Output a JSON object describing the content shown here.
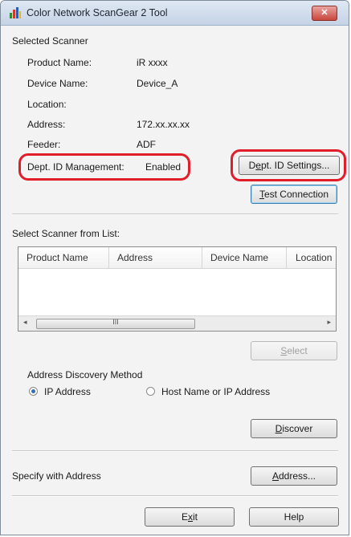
{
  "window": {
    "title": "Color Network ScanGear 2 Tool",
    "close_glyph": "✕"
  },
  "selected_scanner": {
    "heading": "Selected Scanner",
    "rows": [
      {
        "label": "Product Name:",
        "value": "iR xxxx"
      },
      {
        "label": "Device Name:",
        "value": "Device_A"
      },
      {
        "label": "Location:",
        "value": ""
      },
      {
        "label": "Address:",
        "value": "172.xx.xx.xx"
      },
      {
        "label": "Feeder:",
        "value": "ADF"
      },
      {
        "label": "Dept. ID Management:",
        "value": "Enabled"
      }
    ],
    "dept_id_settings_button": {
      "prefix": "D",
      "mnemonic": "e",
      "suffix": "pt. ID Settings..."
    },
    "test_connection_button": {
      "mnemonic": "T",
      "suffix": "est Connection"
    }
  },
  "scanner_list": {
    "heading": "Select Scanner from List:",
    "heading_mnemonic": "L",
    "columns": [
      "Product Name",
      "Address",
      "Device Name",
      "Location"
    ],
    "rows": [],
    "scroll_left": "◂",
    "scroll_right": "▸",
    "scroll_grip": "III",
    "select_button": {
      "mnemonic": "S",
      "suffix": "elect"
    }
  },
  "discovery": {
    "heading": "Address Discovery Method",
    "heading_mnemonic": "M",
    "options": [
      {
        "label": "IP Address",
        "checked": true
      },
      {
        "label": "Host Name or IP Address",
        "checked": false
      }
    ],
    "discover_button": {
      "mnemonic": "D",
      "suffix": "iscover"
    }
  },
  "specify": {
    "label": "Specify with Address",
    "address_button": {
      "mnemonic": "A",
      "suffix": "ddress..."
    }
  },
  "footer": {
    "exit_button": {
      "prefix": "E",
      "mnemonic": "x",
      "suffix": "it"
    },
    "help_button": "Help"
  },
  "colors": {
    "highlight": "#e21d2a",
    "accent": "#3c7fb1",
    "disabled_text": "#a0a0a0"
  }
}
